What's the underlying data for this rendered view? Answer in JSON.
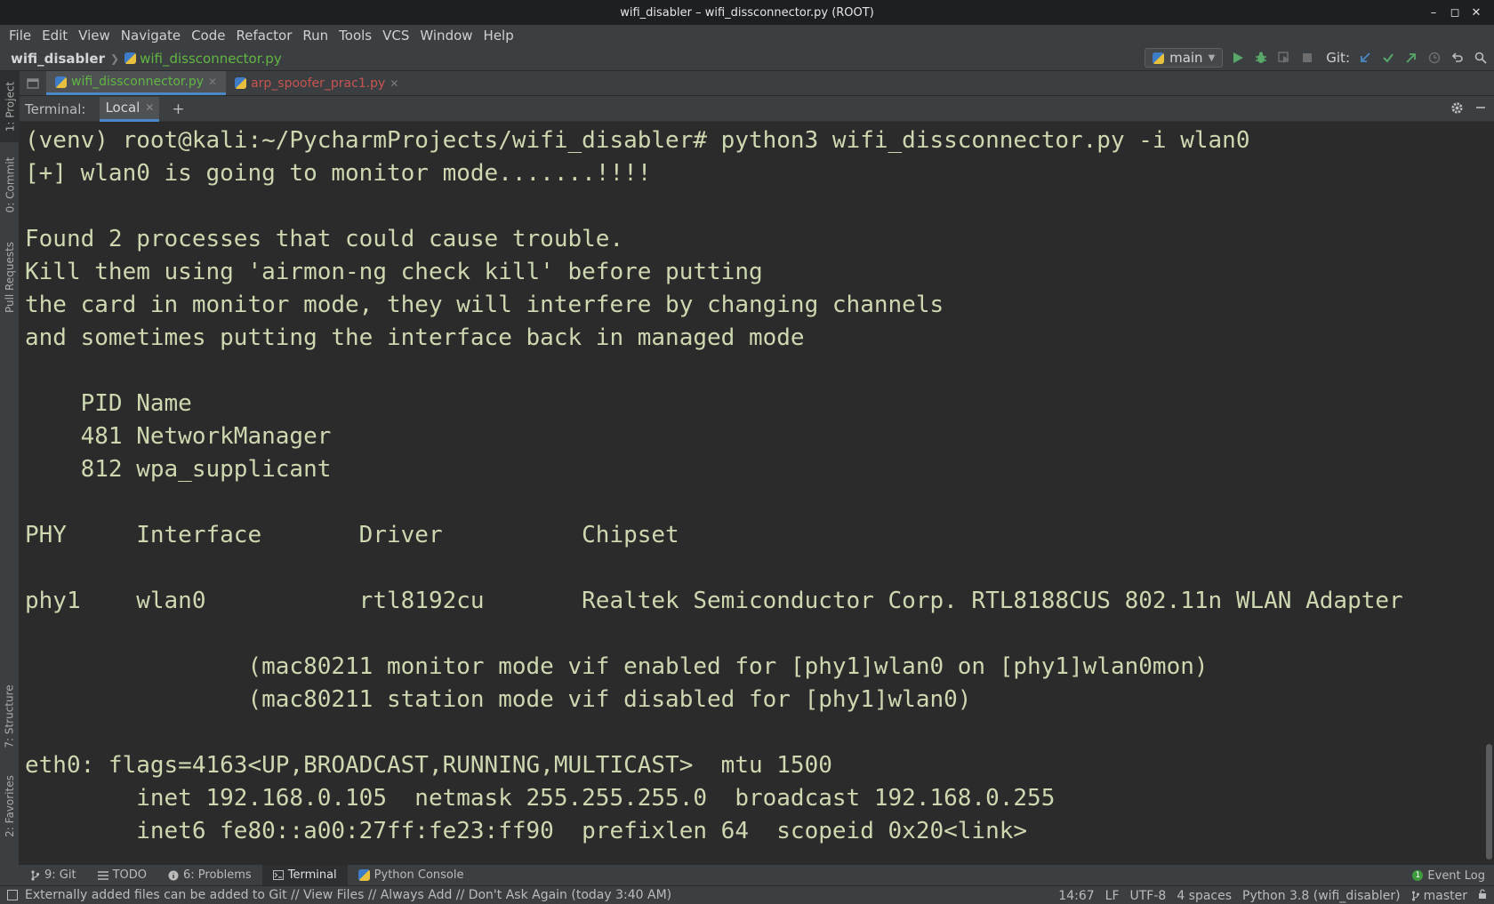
{
  "window": {
    "title": "wifi_disabler – wifi_dissconnector.py (ROOT)",
    "controls": {
      "minimize": "–",
      "maximize": "◻",
      "close": "✕"
    }
  },
  "menu": [
    "File",
    "Edit",
    "View",
    "Navigate",
    "Code",
    "Refactor",
    "Run",
    "Tools",
    "VCS",
    "Window",
    "Help"
  ],
  "nav": {
    "project": "wifi_disabler",
    "file": "wifi_dissconnector.py",
    "run_config": "main",
    "git_label": "Git:"
  },
  "editor_tabs": [
    {
      "label": "wifi_dissconnector.py",
      "active": true
    },
    {
      "label": "arp_spoofer_prac1.py",
      "active": false
    }
  ],
  "side_tabs": {
    "project": "1: Project",
    "commit": "0: Commit",
    "pull_requests": "Pull Requests",
    "structure": "7: Structure",
    "favorites": "2: Favorites"
  },
  "terminal": {
    "label": "Terminal:",
    "tab": "Local",
    "lines": [
      "(venv) root@kali:~/PycharmProjects/wifi_disabler# python3 wifi_dissconnector.py -i wlan0",
      "[+] wlan0 is going to monitor mode.......!!!!",
      "",
      "Found 2 processes that could cause trouble.",
      "Kill them using 'airmon-ng check kill' before putting",
      "the card in monitor mode, they will interfere by changing channels",
      "and sometimes putting the interface back in managed mode",
      "",
      "    PID Name",
      "    481 NetworkManager",
      "    812 wpa_supplicant",
      "",
      "PHY     Interface       Driver          Chipset",
      "",
      "phy1    wlan0           rtl8192cu       Realtek Semiconductor Corp. RTL8188CUS 802.11n WLAN Adapter",
      "",
      "                (mac80211 monitor mode vif enabled for [phy1]wlan0 on [phy1]wlan0mon)",
      "                (mac80211 station mode vif disabled for [phy1]wlan0)",
      "",
      "eth0: flags=4163<UP,BROADCAST,RUNNING,MULTICAST>  mtu 1500",
      "        inet 192.168.0.105  netmask 255.255.255.0  broadcast 192.168.0.255",
      "        inet6 fe80::a00:27ff:fe23:ff90  prefixlen 64  scopeid 0x20<link>"
    ]
  },
  "toolwindows": {
    "git": "9: Git",
    "todo": "TODO",
    "problems": "6: Problems",
    "terminal": "Terminal",
    "python_console": "Python Console",
    "event_log": "Event Log",
    "event_count": "1"
  },
  "status": {
    "message": "Externally added files can be added to Git // View Files // Always Add // Don't Ask Again (today 3:40 AM)",
    "position": "14:67",
    "line_sep": "LF",
    "encoding": "UTF-8",
    "indent": "4 spaces",
    "interpreter": "Python 3.8 (wifi_disabler)",
    "branch": "master"
  },
  "colors": {
    "accent": "#4a88c7",
    "terminal_bg": "#2b2b2b",
    "terminal_fg": "#cdd8b0",
    "modified_file": "#62b543",
    "error_file": "#c75450"
  }
}
